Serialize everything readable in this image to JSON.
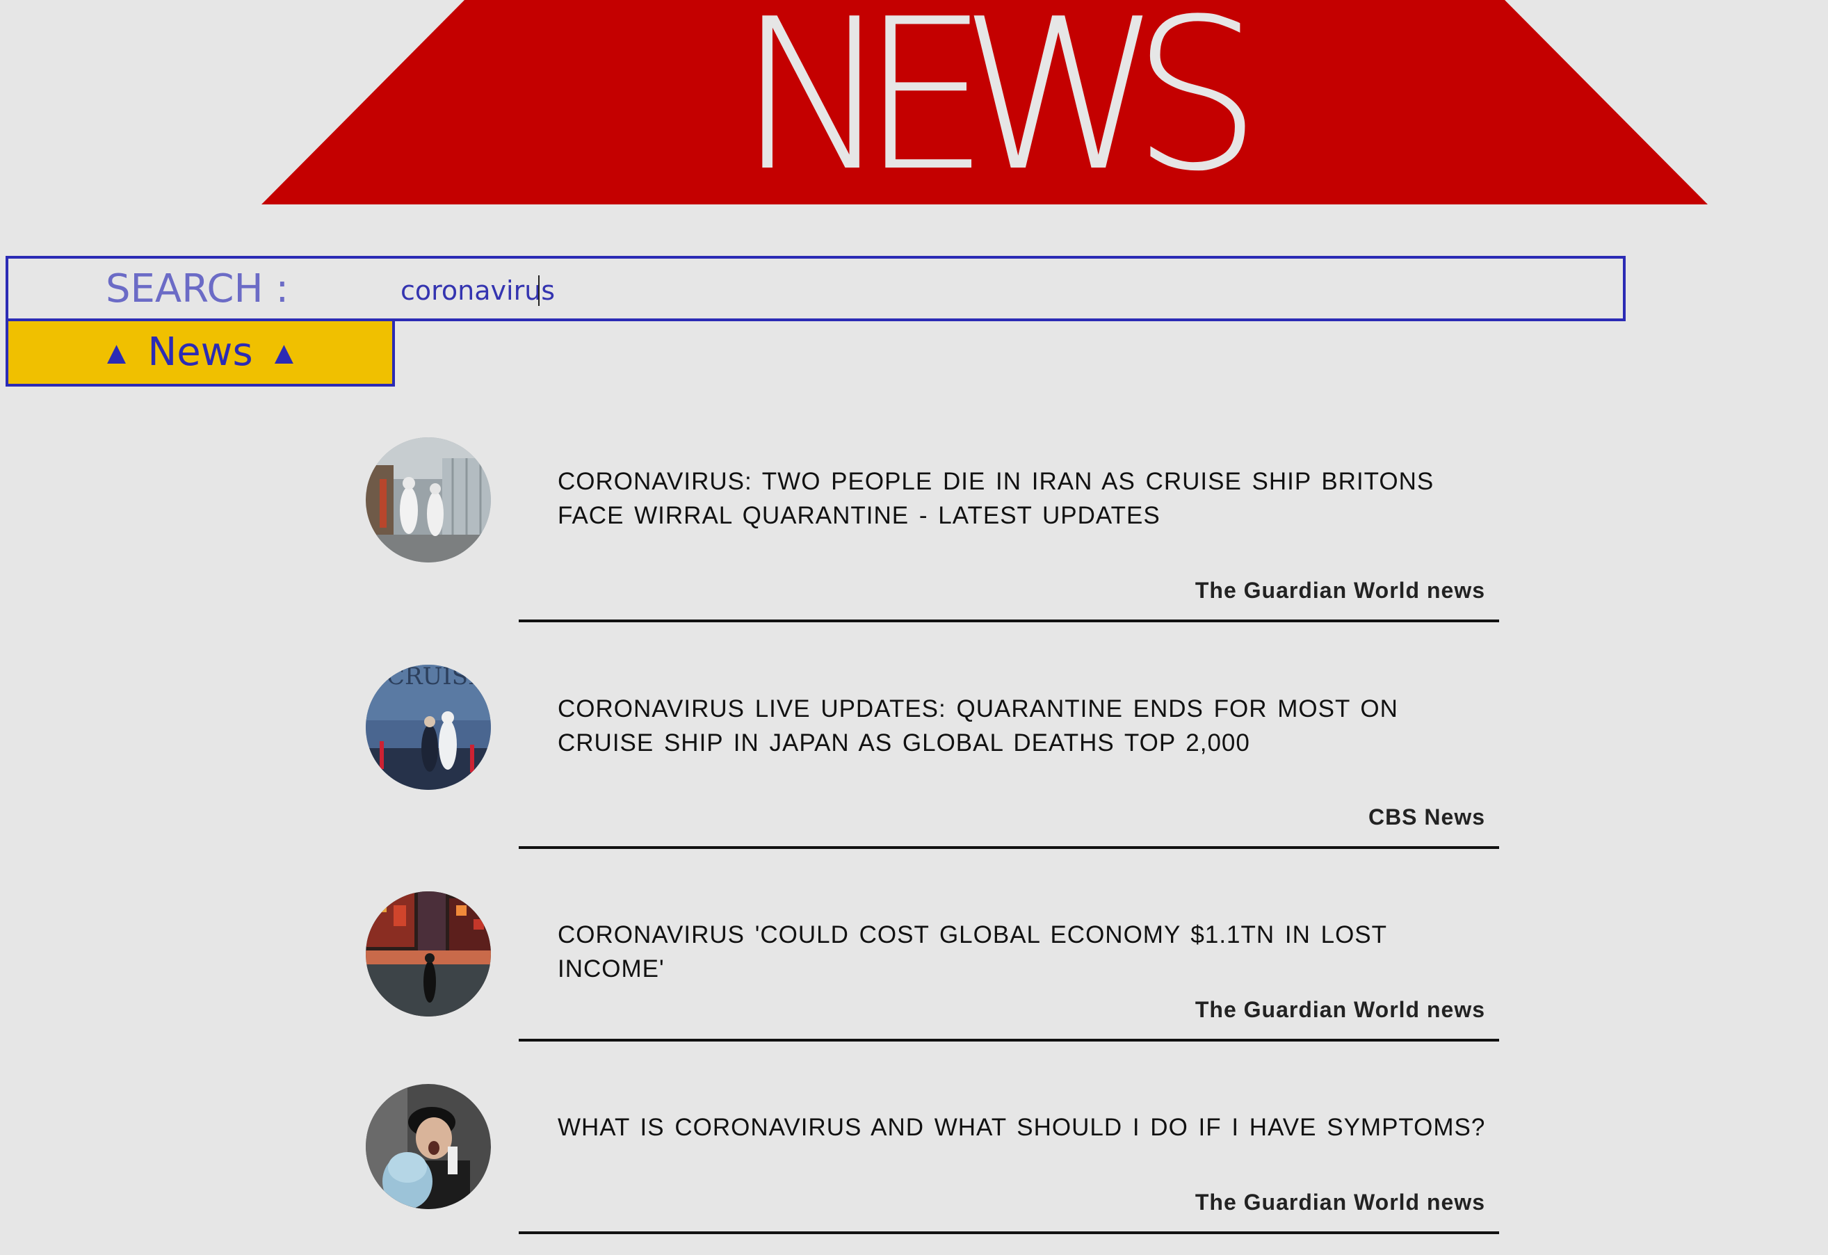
{
  "banner": {
    "title": "NEWS",
    "color": "#c40000",
    "text_color": "#e6e6e6"
  },
  "search": {
    "label": "SEARCH :",
    "value": "coronavirus",
    "placeholder": ""
  },
  "news_toggle": {
    "label": "News",
    "left_icon": "▲",
    "right_icon": "▲",
    "icon_name": "triangle-up-icon",
    "background": "#f0c000"
  },
  "articles": [
    {
      "headline": "CORONAVIRUS: TWO PEOPLE DIE IN IRAN AS CRUISE SHIP BRITONS FACE WIRRAL QUARANTINE - LATEST UPDATES",
      "source": "The Guardian World news"
    },
    {
      "headline": "CORONAVIRUS LIVE UPDATES: QUARANTINE ENDS FOR MOST ON CRUISE SHIP IN JAPAN AS GLOBAL DEATHS TOP 2,000",
      "source": "CBS News"
    },
    {
      "headline": "CORONAVIRUS 'COULD COST GLOBAL ECONOMY $1.1TN IN LOST INCOME'",
      "source": "The Guardian World news"
    },
    {
      "headline": "WHAT IS CORONAVIRUS AND WHAT SHOULD I DO IF I HAVE SYMPTOMS?",
      "source": "The Guardian World news"
    }
  ]
}
